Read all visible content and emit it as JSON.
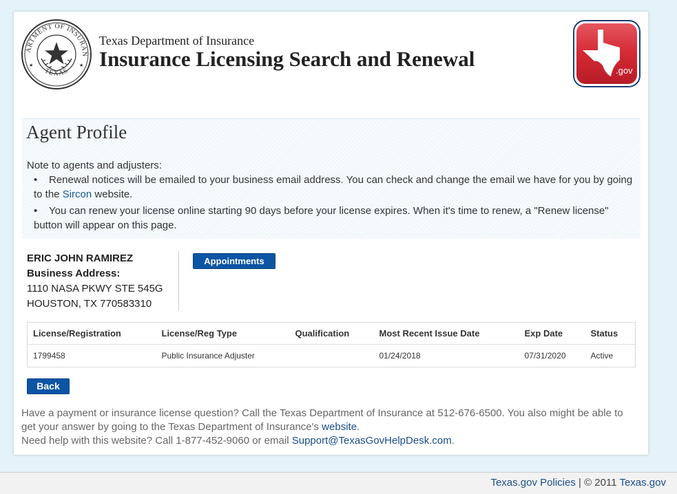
{
  "header": {
    "agency": "Texas Department of Insurance",
    "title": "Insurance Licensing Search and Renewal",
    "seal_text_top": "DEPARTMENT OF INSURANCE",
    "seal_text_bottom": "TEXAS",
    "texasgov_logo_text": ".gov"
  },
  "profile": {
    "title": "Agent Profile",
    "note_intro": "Note to agents and adjusters:",
    "note1_pre": "Renewal notices will be emailed to your business email address. You can check and change the email we have for you by going to the ",
    "note1_link": "Sircon",
    "note1_post": " website.",
    "note2": "You can renew your license online starting 90 days before your license expires. When it's time to renew, a \"Renew license\" button will appear on this page."
  },
  "agent": {
    "name": "ERIC JOHN RAMIREZ",
    "address_label": "Business Address:",
    "address_line1": "1110 NASA PKWY STE 545G",
    "address_line2": "HOUSTON, TX 770583310"
  },
  "buttons": {
    "appointments": "Appointments",
    "back": "Back"
  },
  "license_table": {
    "headers": [
      "License/Registration",
      "License/Reg Type",
      "Qualification",
      "Most Recent Issue Date",
      "Exp Date",
      "Status"
    ],
    "rows": [
      [
        "1799458",
        "Public Insurance Adjuster",
        "",
        "01/24/2018",
        "07/31/2020",
        "Active"
      ]
    ]
  },
  "help": {
    "line1_pre": "Have a payment or insurance license question? Call the Texas Department of Insurance at 512-676-6500. You also might be able to get your answer by going to the Texas Department of Insurance's ",
    "line1_link": "website",
    "line1_post": ".",
    "line2_pre": "Need help with this website? Call 1-877-452-9060 or email ",
    "line2_link": "Support@TexasGovHelpDesk.com",
    "line2_post": "."
  },
  "footer": {
    "policies_link": "Texas.gov Policies",
    "separator": " | © 2011 ",
    "site_link": "Texas.gov"
  },
  "colors": {
    "button": "#0c55a5",
    "link": "#1a4e8a",
    "page_bg": "#e4f2f9",
    "logo_red": "#d42a35"
  }
}
